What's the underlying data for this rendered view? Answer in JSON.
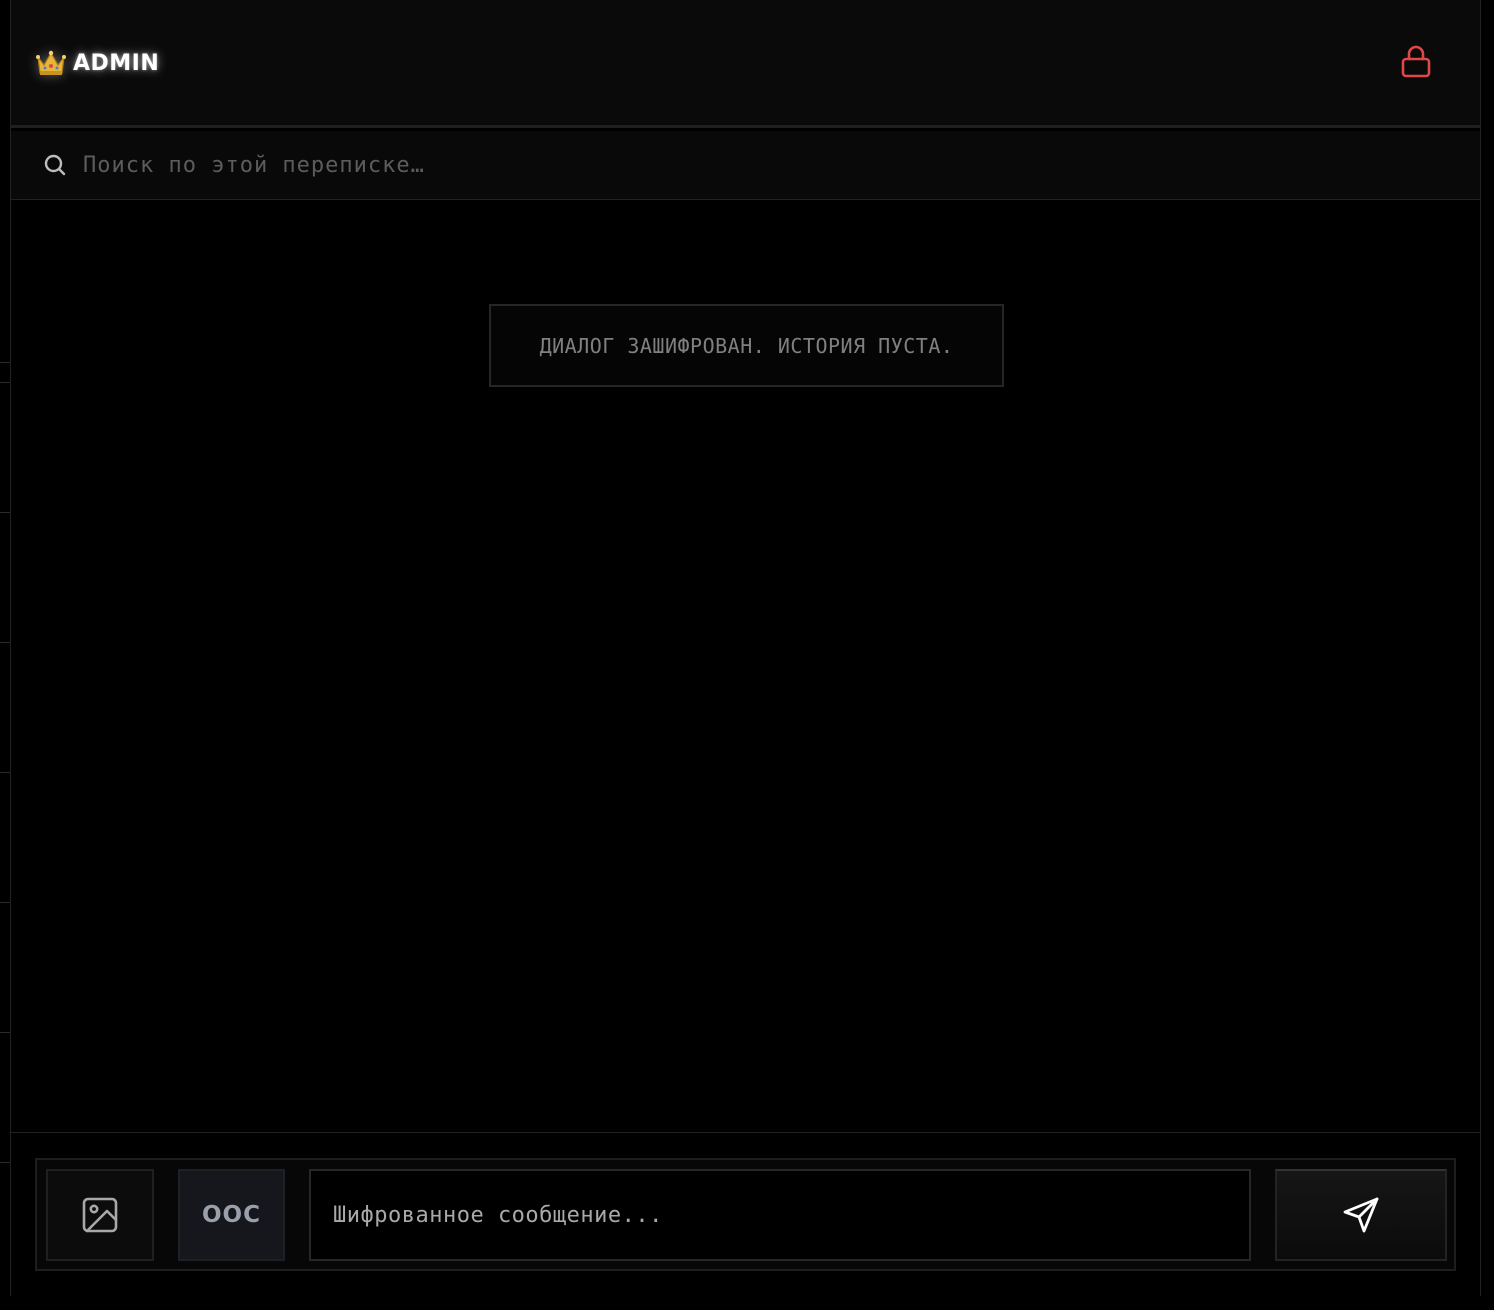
{
  "header": {
    "crown_icon": "👑",
    "user_name": "ADMIN",
    "lock_icon": "lock-icon",
    "lock_color": "#e04848"
  },
  "search": {
    "placeholder": "Поиск по этой переписке…"
  },
  "messages": {
    "empty_notice": "ДИАЛОГ ЗАШИФРОВАН. ИСТОРИЯ ПУСТА."
  },
  "composer": {
    "attach_icon": "image-icon",
    "ooc_label": "OOC",
    "input_placeholder": "Шифрованное сообщение...",
    "send_icon": "send-icon"
  },
  "colors": {
    "background": "#000000",
    "header_bg": "#0a0a0a",
    "accent_red": "#e04848",
    "text_primary": "#ffffff",
    "text_muted": "#808080"
  }
}
